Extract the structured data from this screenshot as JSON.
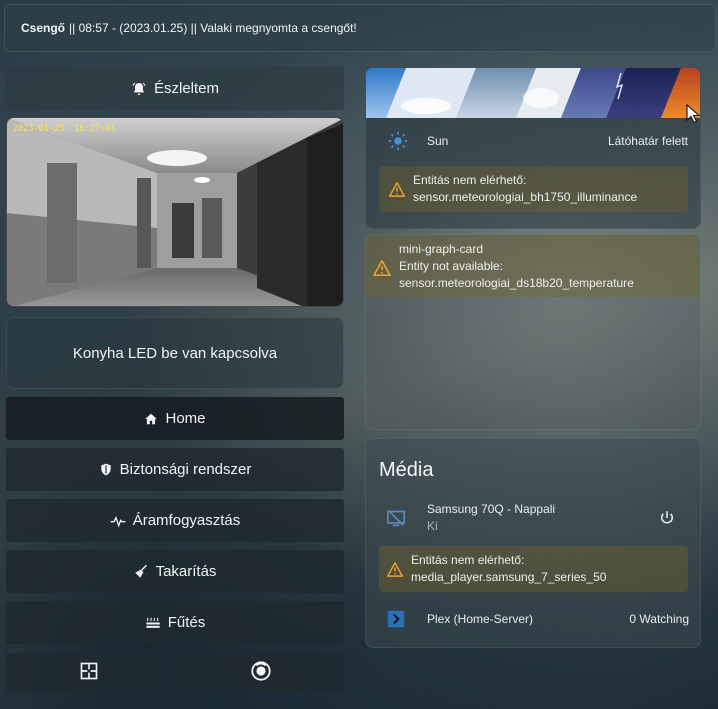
{
  "notification": {
    "source": "Csengő",
    "text": " || 08:57 - (2023.01.25) || Valaki megnyomta a csengőt!"
  },
  "doorbell_button": {
    "label": "Észleltem",
    "icon": "bell-ring-icon"
  },
  "camera": {
    "timestamp": "2023-01-25  16:27:44"
  },
  "kitchen_led": {
    "label": "Konyha LED be van kapcsolva"
  },
  "nav": {
    "home": "Home",
    "security": "Biztonsági rendszer",
    "power": "Áramfogyasztás",
    "cleaning": "Takarítás",
    "heating": "Fűtés"
  },
  "weather": {
    "sun_label": "Sun",
    "sun_state": "Látóhatár felett",
    "warning_title": "Entitás nem elérhető:",
    "warning_entity": "sensor.meteorologiai_bh1750_illuminance"
  },
  "graph": {
    "title": "mini-graph-card",
    "line1": "Entity not available:",
    "line2": "sensor.meteorologiai_ds18b20_temperature"
  },
  "media": {
    "title": "Média",
    "device_name": "Samsung 70Q - Nappali",
    "device_state": "Ki",
    "warning_title": "Entitás nem elérhető:",
    "warning_entity": "media_player.samsung_7_series_50",
    "plex_name": "Plex (Home-Server)",
    "plex_state": "0 Watching"
  },
  "colors": {
    "warning": "#f0a22b",
    "sun": "#4a90d9",
    "plex": "#2f6fb5"
  }
}
